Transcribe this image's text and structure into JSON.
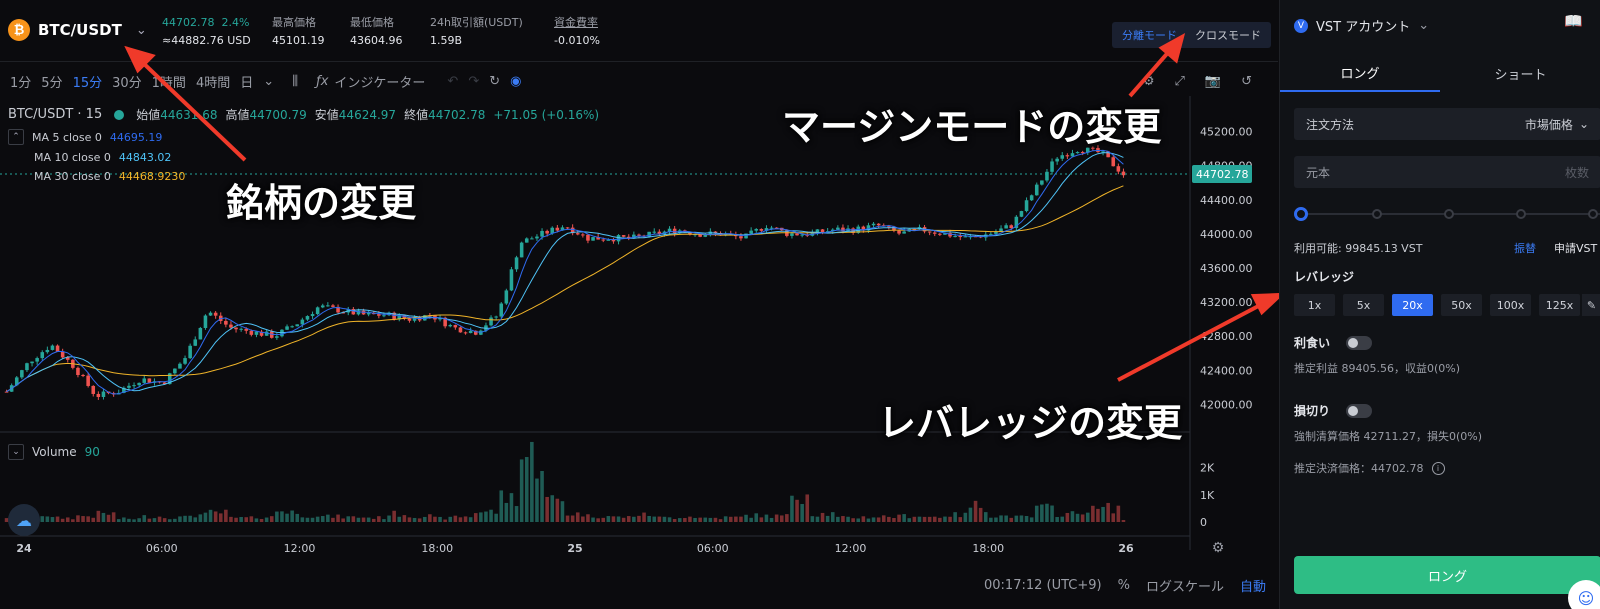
{
  "header": {
    "symbol": "BTC/USDT",
    "coin_glyph": "₿",
    "last_price": "44702.78",
    "change_pct": "2.4%",
    "approx_usd": "≈44882.76 USD",
    "high_label": "最高価格",
    "high_value": "45101.19",
    "low_label": "最低価格",
    "low_value": "43604.96",
    "vol_label": "24h取引額(USDT)",
    "vol_value": "1.59B",
    "funding_label": "資金費率",
    "funding_value": "-0.010%"
  },
  "margin_mode": {
    "isolated": "分離モード",
    "cross": "クロスモード"
  },
  "toolbar": {
    "intervals": [
      "1分",
      "5分",
      "15分",
      "30分",
      "1時間",
      "4時間",
      "日"
    ],
    "active_interval": "15分",
    "indicator_label": "インジケーター"
  },
  "chart_legend": {
    "title": "BTC/USDT · 15",
    "open_label": "始値",
    "open": "44631.68",
    "high_label": "高値",
    "high": "44700.79",
    "low_label": "安値",
    "low": "44624.97",
    "close_label": "終値",
    "close": "44702.78",
    "change": "+71.05 (+0.16%)",
    "ma5_label": "MA 5 close 0",
    "ma5_value": "44695.19",
    "ma10_label": "MA 10 close 0",
    "ma10_value": "44843.02",
    "ma30_label": "MA 30 close 0",
    "ma30_value": "44468.9230",
    "volume_label": "Volume",
    "volume_value": "90"
  },
  "chart_data": {
    "type": "candlestick",
    "y_ticks": [
      "45200.00",
      "44800.00",
      "44400.00",
      "44000.00",
      "43600.00",
      "43200.00",
      "42800.00",
      "42400.00",
      "42000.00"
    ],
    "price_marker": "44702.78",
    "ylim": [
      41700,
      45500
    ],
    "x_ticks": [
      "24",
      "06:00",
      "12:00",
      "18:00",
      "25",
      "06:00",
      "12:00",
      "18:00",
      "26"
    ],
    "volume_ticks": [
      "2K",
      "1K",
      "0"
    ],
    "volume_ylim": [
      0,
      2800
    ],
    "close_path": [
      42150,
      42500,
      42700,
      42450,
      42100,
      42150,
      42300,
      42250,
      42550,
      43100,
      42900,
      42850,
      42800,
      42950,
      43150,
      43100,
      43050,
      43050,
      43000,
      43050,
      42900,
      42850,
      43050,
      43900,
      44000,
      44100,
      43950,
      43950,
      43950,
      44000,
      44050,
      44000,
      44000,
      43950,
      44100,
      44000,
      44000,
      44050,
      44050,
      44100,
      44000,
      44050,
      44000,
      43950,
      44000,
      44100,
      44500,
      44900,
      45000,
      44950,
      44700
    ],
    "volumes": [
      180,
      260,
      150,
      220,
      300,
      120,
      200,
      170,
      260,
      340,
      150,
      180,
      420,
      250,
      200,
      180,
      160,
      300,
      220,
      140,
      200,
      380,
      900,
      2400,
      800,
      300,
      220,
      180,
      260,
      160,
      200,
      150,
      170,
      240,
      220,
      1100,
      300,
      160,
      180,
      200,
      230,
      190,
      260,
      600,
      220,
      180,
      500,
      300,
      450,
      520,
      90
    ]
  },
  "annotations": {
    "symbol_change": "銘柄の変更",
    "margin_change": "マージンモードの変更",
    "leverage_change": "レバレッジの変更"
  },
  "status": {
    "time": "00:17:12 (UTC+9)",
    "pct": "%",
    "log": "ログスケール",
    "auto": "自動"
  },
  "order_panel": {
    "account": "VST アカウント",
    "long_tab": "ロング",
    "short_tab": "ショート",
    "order_type_label": "注文方法",
    "order_type_value": "市場価格",
    "principal_placeholder": "元本",
    "unit_label": "枚数",
    "available": "利用可能: 99845.13 VST",
    "transfer": "振替",
    "claim": "申請VST",
    "leverage_label": "レバレッジ",
    "leverage_options": [
      "1x",
      "5x",
      "20x",
      "50x",
      "100x",
      "125x"
    ],
    "leverage_selected": "20x",
    "tp_label": "利食い",
    "tp_estimate": "推定利益 89405.56，収益0(0%)",
    "sl_label": "損切り",
    "sl_estimate": "強制清算価格 42711.27，損失0(0%)",
    "settle_price": "推定決済価格：44702.78",
    "submit": "ロング"
  }
}
